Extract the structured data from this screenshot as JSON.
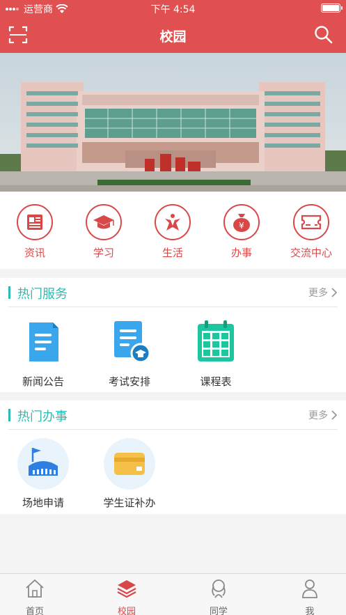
{
  "status_bar": {
    "carrier": "运营商",
    "time": "下午 4:54"
  },
  "header": {
    "title": "校园",
    "scan_icon": "scan-icon",
    "search_icon": "search-icon"
  },
  "quick_nav": [
    {
      "label": "资讯",
      "icon": "news-icon"
    },
    {
      "label": "学习",
      "icon": "graduation-cap-icon"
    },
    {
      "label": "生活",
      "icon": "life-icon"
    },
    {
      "label": "办事",
      "icon": "money-bag-icon"
    },
    {
      "label": "交流中心",
      "icon": "ticket-icon"
    }
  ],
  "hot_services": {
    "title": "热门服务",
    "more": "更多",
    "items": [
      {
        "label": "新闻公告",
        "icon": "document-icon"
      },
      {
        "label": "考试安排",
        "icon": "exam-icon"
      },
      {
        "label": "课程表",
        "icon": "calendar-icon"
      }
    ]
  },
  "hot_affairs": {
    "title": "热门办事",
    "more": "更多",
    "items": [
      {
        "label": "场地申请",
        "icon": "stadium-icon"
      },
      {
        "label": "学生证补办",
        "icon": "card-icon"
      }
    ]
  },
  "tab_bar": [
    {
      "label": "首页",
      "icon": "home-icon",
      "active": false
    },
    {
      "label": "校园",
      "icon": "layers-icon",
      "active": true
    },
    {
      "label": "同学",
      "icon": "classmates-icon",
      "active": false
    },
    {
      "label": "我",
      "icon": "person-icon",
      "active": false
    }
  ],
  "colors": {
    "brand_red": "#e05050",
    "accent_teal": "#2bbbb3",
    "icon_blue": "#2e9fe6"
  }
}
